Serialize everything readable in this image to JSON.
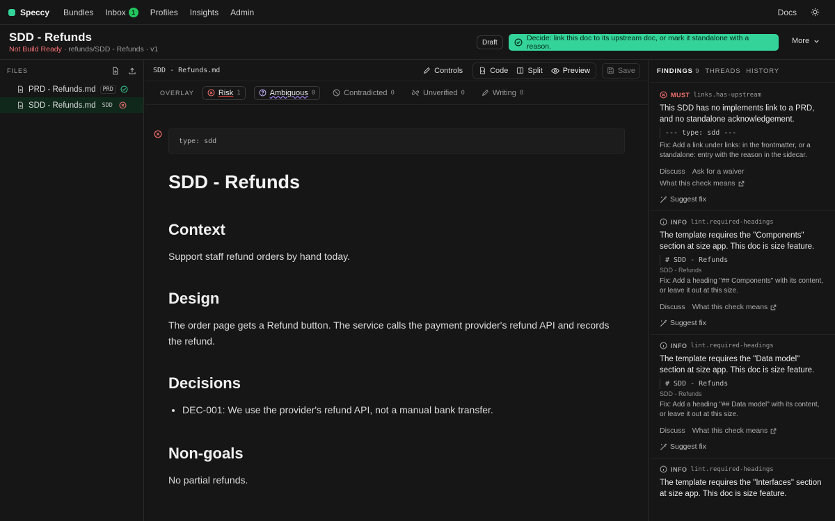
{
  "nav": {
    "brand": "Speccy",
    "links": [
      "Bundles",
      "Inbox",
      "Profiles",
      "Insights",
      "Admin"
    ],
    "inbox_count": "1",
    "docs": "Docs"
  },
  "header": {
    "title": "SDD - Refunds",
    "status": "Not Build Ready",
    "path": " · refunds/SDD - Refunds · v1",
    "draft": "Draft",
    "decide": "Decide: link this doc to its upstream doc, or mark it standalone with a reason.",
    "more": "More"
  },
  "sidebar": {
    "heading": "FILES",
    "files": [
      {
        "name": "PRD - Refunds.md",
        "tag": "PRD",
        "status": "ok"
      },
      {
        "name": "SDD - Refunds.md",
        "tag": "SDD",
        "status": "error"
      }
    ]
  },
  "editor": {
    "filename": "SDD - Refunds.md",
    "toolbar": {
      "controls": "Controls",
      "code": "Code",
      "split": "Split",
      "preview": "Preview",
      "save": "Save"
    },
    "overlay_label": "OVERLAY",
    "overlays": [
      {
        "label": "Risk",
        "count": "1"
      },
      {
        "label": "Ambiguous",
        "count": "0"
      },
      {
        "label": "Contradicted",
        "count": "0"
      },
      {
        "label": "Unverified",
        "count": "0"
      },
      {
        "label": "Writing",
        "count": "8"
      }
    ],
    "frontmatter": "type: sdd",
    "doc": {
      "h1": "SDD - Refunds",
      "context_h": "Context",
      "context_p": "Support staff refund orders by hand today.",
      "design_h": "Design",
      "design_p": "The order page gets a Refund button. The service calls the payment provider's refund API and records the refund.",
      "decisions_h": "Decisions",
      "decisions_li": "DEC-001: We use the provider's refund API, not a manual bank transfer.",
      "nongoals_h": "Non-goals",
      "nongoals_p": "No partial refunds."
    }
  },
  "panel": {
    "tabs": {
      "findings": "FINDINGS",
      "findings_count": "9",
      "threads": "THREADS",
      "history": "HISTORY"
    },
    "findings": [
      {
        "level": "MUST",
        "code": "links.has-upstream",
        "msg": "This SDD has no implements link to a PRD, and no standalone acknowledgement.",
        "quote": "--- type: sdd ---",
        "fix": "Fix: Add a link under links: in the frontmatter, or a standalone: entry with the reason in the sidecar.",
        "discuss": "Discuss",
        "waiver": "Ask for a waiver",
        "means": "What this check means",
        "suggest": "Suggest fix"
      },
      {
        "level": "INFO",
        "code": "lint.required-headings",
        "msg": "The template requires the \"Components\" section at size app. This doc is size feature.",
        "quote": "# SDD - Refunds",
        "loc": "SDD - Refunds",
        "fix": "Fix: Add a heading \"## Components\" with its content, or leave it out at this size.",
        "discuss": "Discuss",
        "means": "What this check means",
        "suggest": "Suggest fix"
      },
      {
        "level": "INFO",
        "code": "lint.required-headings",
        "msg": "The template requires the \"Data model\" section at size app. This doc is size feature.",
        "quote": "# SDD - Refunds",
        "loc": "SDD - Refunds",
        "fix": "Fix: Add a heading \"## Data model\" with its content, or leave it out at this size.",
        "discuss": "Discuss",
        "means": "What this check means",
        "suggest": "Suggest fix"
      },
      {
        "level": "INFO",
        "code": "lint.required-headings",
        "msg": "The template requires the \"Interfaces\" section at size app. This doc is size feature."
      }
    ]
  },
  "colors": {
    "accent": "#34d399",
    "error": "#f87171",
    "bg": "#161616"
  }
}
